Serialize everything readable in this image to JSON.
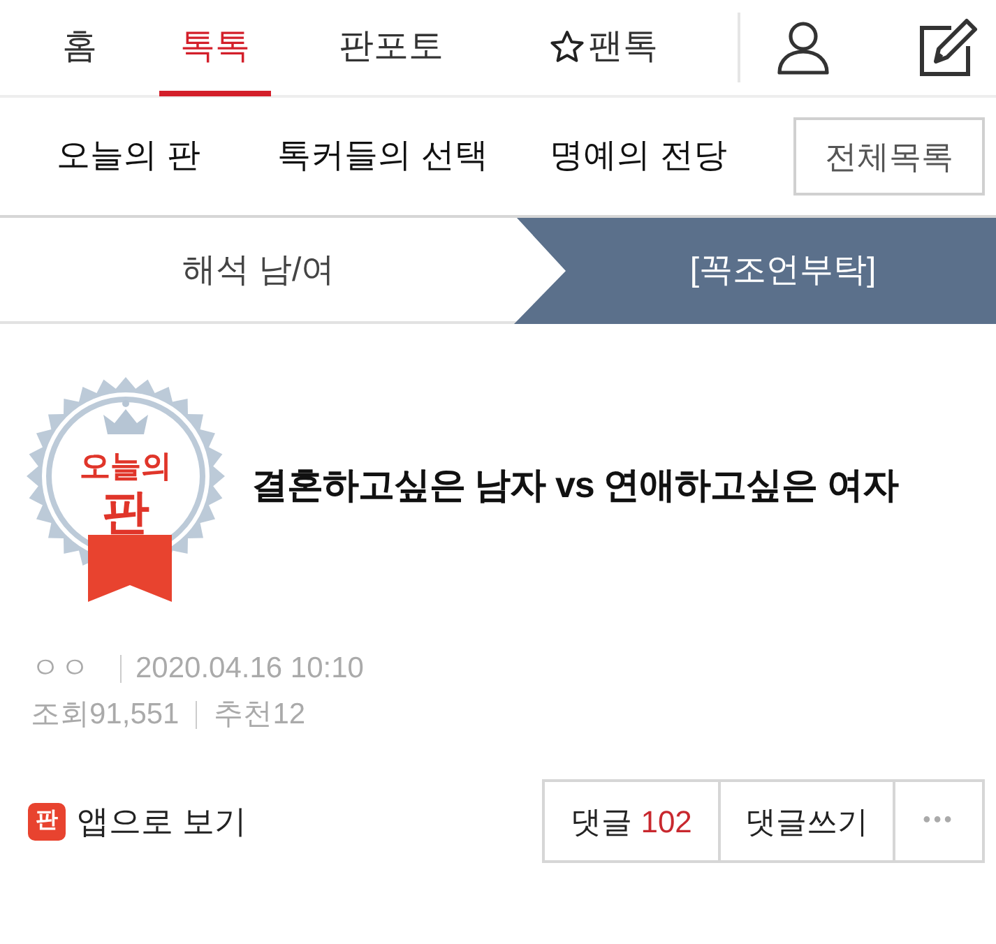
{
  "top_nav": {
    "tabs": [
      {
        "label": "홈",
        "selected": false,
        "kind": "plain"
      },
      {
        "label": "톡톡",
        "selected": true,
        "kind": "plain"
      },
      {
        "label": "판포토",
        "selected": false,
        "kind": "plain"
      },
      {
        "label": "팬톡",
        "selected": false,
        "kind": "starred"
      }
    ]
  },
  "sub_nav": {
    "items": [
      {
        "label": "오늘의 판"
      },
      {
        "label": "톡커들의 선택"
      },
      {
        "label": "명예의 전당"
      }
    ],
    "all_button": "전체목록"
  },
  "breadcrumb": [
    {
      "label": "해석 남/여",
      "selected": false
    },
    {
      "label": "[꼭조언부탁]",
      "selected": true
    }
  ],
  "post": {
    "badge": {
      "line_1": "오늘의",
      "line_2": "판"
    },
    "title": "결혼하고싶은 남자 vs 연애하고싶은 여자",
    "author": "ㅇㅇ",
    "date": "2020.04.16 10:10",
    "views": "조회91,551",
    "recommends": "추천12"
  },
  "footer": {
    "app_icon_text": "판",
    "app_link": "앱으로 보기",
    "comment_label": "댓글",
    "comment_count": "102",
    "write_comment": "댓글쓰기",
    "more": "•••"
  }
}
